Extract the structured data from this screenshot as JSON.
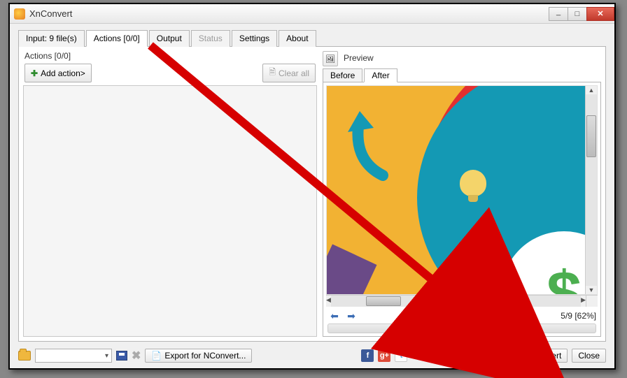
{
  "title": "XnConvert",
  "tabs": {
    "input": "Input: 9 file(s)",
    "actions": "Actions [0/0]",
    "output": "Output",
    "status": "Status",
    "settings": "Settings",
    "about": "About"
  },
  "actions_panel": {
    "label": "Actions [0/0]",
    "add_action": "Add action>",
    "clear_all": "Clear all"
  },
  "preview": {
    "label": "Preview",
    "before": "Before",
    "after": "After",
    "status": "5/9 [62%]",
    "dollar": "$"
  },
  "bottom": {
    "export": "Export for NConvert...",
    "convert": "Convert",
    "close": "Close",
    "social": {
      "fb": "f",
      "gp": "g+",
      "tw": "t"
    }
  }
}
